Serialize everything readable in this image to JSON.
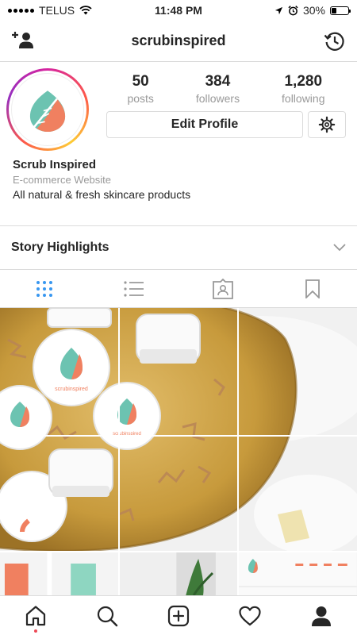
{
  "status_bar": {
    "carrier": "TELUS",
    "time": "11:48 PM",
    "battery": "30%",
    "battery_level": 0.3,
    "icons": [
      "signal-dots-icon",
      "wifi-icon",
      "location-arrow-icon",
      "alarm-icon",
      "battery-icon"
    ]
  },
  "nav": {
    "title": "scrubinspired",
    "left_icon": "add-person-icon",
    "right_icon": "archive-history-icon"
  },
  "profile": {
    "stats": [
      {
        "value": "50",
        "label": "posts"
      },
      {
        "value": "384",
        "label": "followers"
      },
      {
        "value": "1,280",
        "label": "following"
      }
    ],
    "edit_button": "Edit Profile",
    "settings_icon": "gear-icon",
    "name": "Scrub Inspired",
    "category": "E-commerce Website",
    "bio": "All natural & fresh skincare products"
  },
  "highlights": {
    "label": "Story Highlights",
    "icon": "chevron-down-icon"
  },
  "tabs": [
    {
      "icon": "grid-icon",
      "active": true
    },
    {
      "icon": "list-icon",
      "active": false
    },
    {
      "icon": "tagged-icon",
      "active": false
    },
    {
      "icon": "bookmark-icon",
      "active": false
    }
  ],
  "colors": {
    "accent_blue": "#3897f0",
    "leaf_teal": "#6cc3b1",
    "leaf_orange": "#f08060",
    "gold": "#c79a3c",
    "notification_red": "#ed4956",
    "border": "#dbdbdb",
    "muted_text": "#999999"
  },
  "bottom_bar": {
    "items": [
      {
        "icon": "home-icon",
        "active": true
      },
      {
        "icon": "search-icon",
        "active": false
      },
      {
        "icon": "new-post-icon",
        "active": false
      },
      {
        "icon": "heart-icon",
        "active": false
      },
      {
        "icon": "profile-icon",
        "active": false
      }
    ]
  }
}
